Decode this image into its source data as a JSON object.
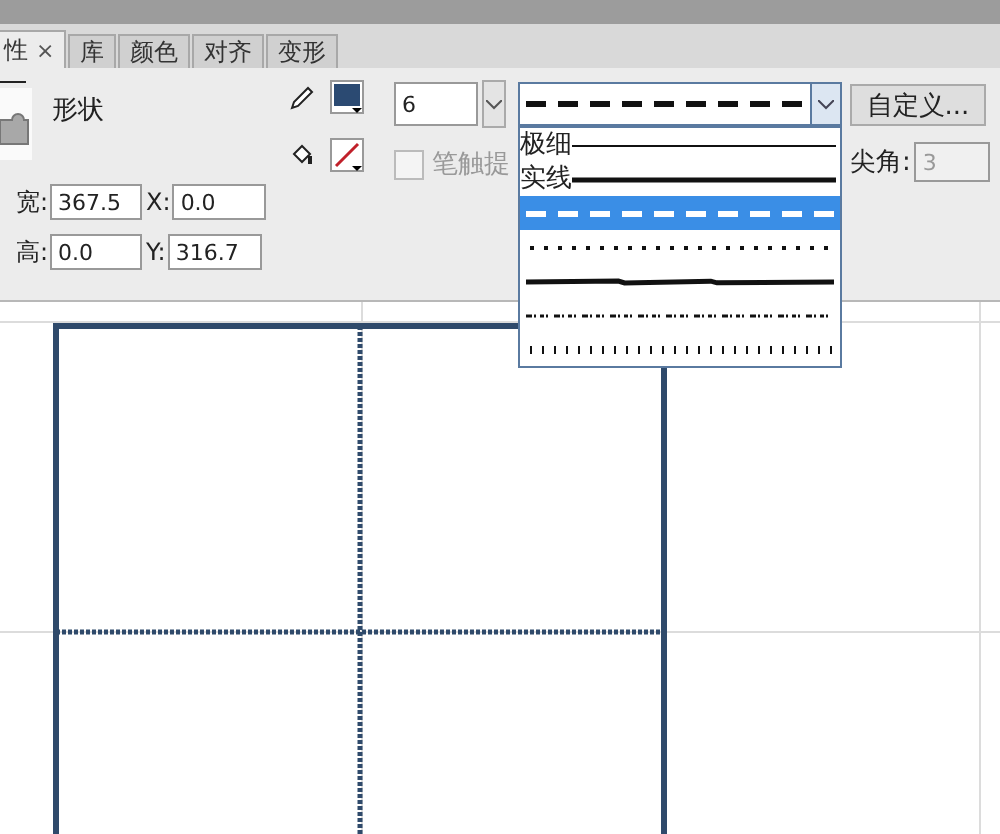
{
  "tabs": [
    {
      "label": "性",
      "close": "×",
      "selected": true
    },
    {
      "label": "库",
      "selected": false
    },
    {
      "label": "颜色",
      "selected": false
    },
    {
      "label": "对齐",
      "selected": false
    },
    {
      "label": "变形",
      "selected": false
    }
  ],
  "object_type": "形状",
  "stroke_size": "6",
  "style_dropdown": {
    "expanded": true,
    "options": [
      {
        "kind": "hairline",
        "label": "极细",
        "selected": false
      },
      {
        "kind": "solid",
        "label": "实线",
        "selected": false
      },
      {
        "kind": "dashed",
        "selected": true
      },
      {
        "kind": "dotted",
        "selected": false
      },
      {
        "kind": "ragged",
        "selected": false
      },
      {
        "kind": "stipple",
        "selected": false
      },
      {
        "kind": "hatched",
        "selected": false
      }
    ]
  },
  "custom_button": "自定义...",
  "stroke_hinting": {
    "label": "笔触提",
    "checked": false
  },
  "miter": {
    "label": "尖角:",
    "value": "3",
    "disabled": true
  },
  "size_fields": [
    [
      {
        "label": "宽:",
        "value": "367.5"
      },
      {
        "label": "X:",
        "value": "0.0"
      }
    ],
    [
      {
        "label": "高:",
        "value": "0.0"
      },
      {
        "label": "Y:",
        "value": "316.7"
      }
    ]
  ]
}
